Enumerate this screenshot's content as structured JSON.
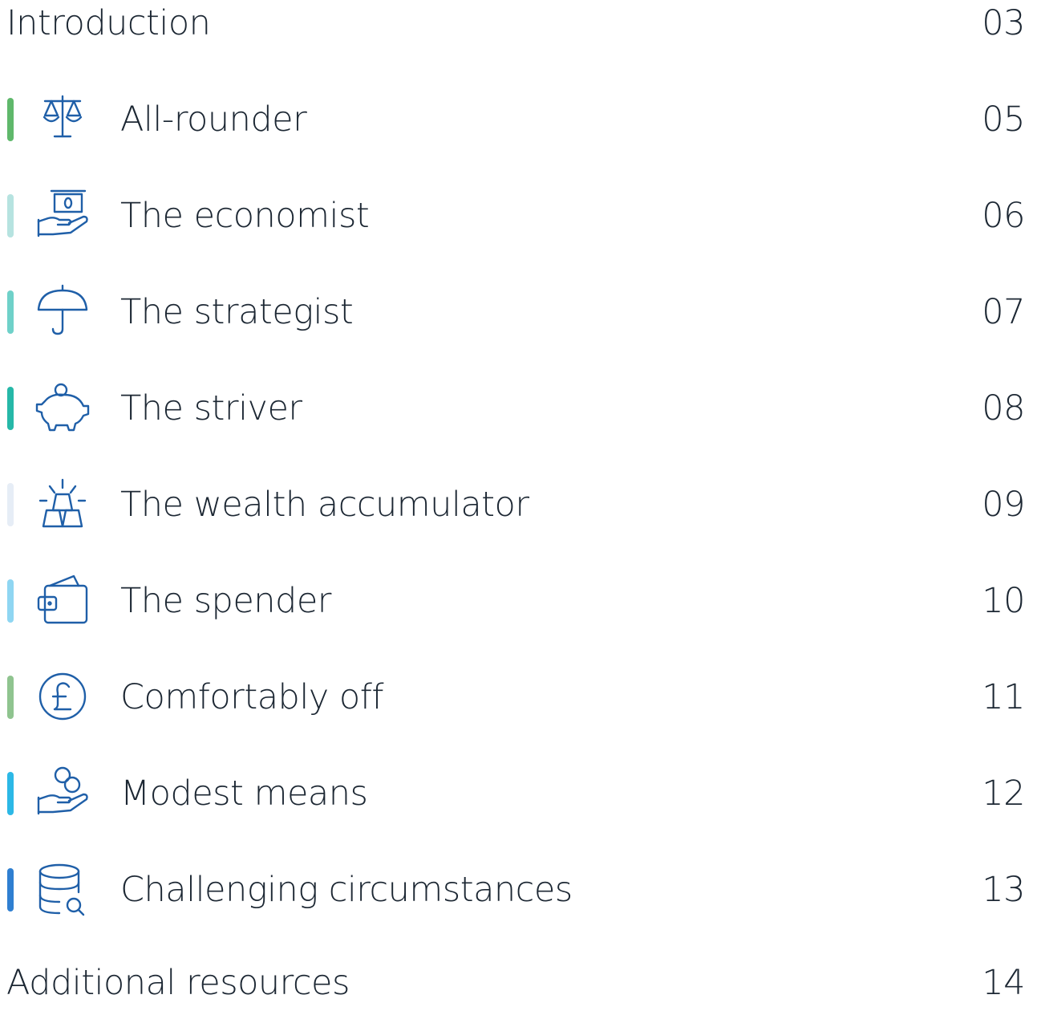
{
  "toc": {
    "intro": {
      "label": "Introduction",
      "page": "03"
    },
    "entries": [
      {
        "label": "All-rounder",
        "page": "05",
        "icon": "scales-icon",
        "color": "#5fb86b"
      },
      {
        "label": "The economist",
        "page": "06",
        "icon": "hand-money-icon",
        "color": "#b6e3e0"
      },
      {
        "label": "The strategist",
        "page": "07",
        "icon": "umbrella-icon",
        "color": "#6fd1c9"
      },
      {
        "label": "The striver",
        "page": "08",
        "icon": "piggy-bank-icon",
        "color": "#26b8a8"
      },
      {
        "label": "The wealth accumulator",
        "page": "09",
        "icon": "gold-bars-icon",
        "color": "#e6edf6"
      },
      {
        "label": "The spender",
        "page": "10",
        "icon": "wallet-icon",
        "color": "#8fd6f2"
      },
      {
        "label": "Comfortably off",
        "page": "11",
        "icon": "pound-coin-icon",
        "color": "#8fc48f"
      },
      {
        "label": "Modest means",
        "page": "12",
        "icon": "hand-coins-icon",
        "color": "#2cb8e6"
      },
      {
        "label": "Challenging circumstances",
        "page": "13",
        "icon": "database-search-icon",
        "color": "#2f7fd1"
      }
    ],
    "resources": {
      "label": "Additional resources",
      "page": "14"
    }
  }
}
